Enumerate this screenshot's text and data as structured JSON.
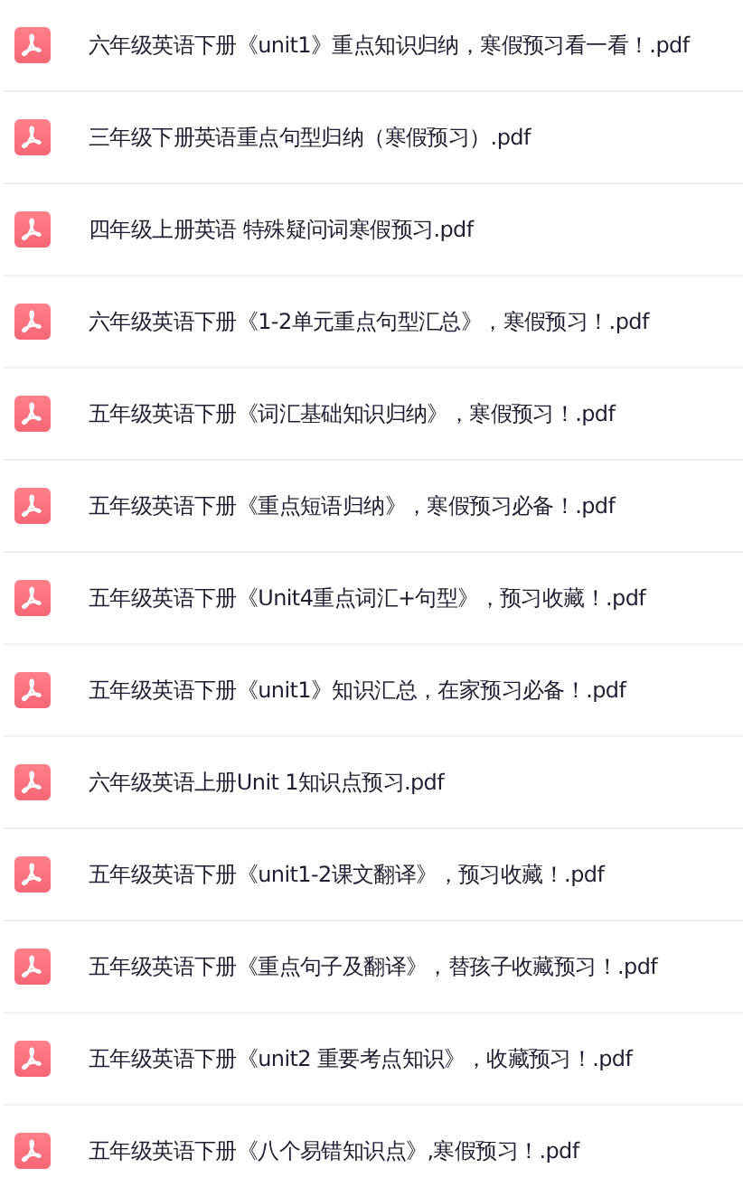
{
  "files": [
    {
      "name": "六年级英语下册《unit1》重点知识归纳，寒假预习看一看！.pdf"
    },
    {
      "name": "三年级下册英语重点句型归纳（寒假预习）.pdf"
    },
    {
      "name": "四年级上册英语 特殊疑问词寒假预习.pdf"
    },
    {
      "name": "六年级英语下册《1-2单元重点句型汇总》，寒假预习！.pdf"
    },
    {
      "name": "五年级英语下册《词汇基础知识归纳》，寒假预习！.pdf"
    },
    {
      "name": "五年级英语下册《重点短语归纳》，寒假预习必备！.pdf"
    },
    {
      "name": "五年级英语下册《Unit4重点词汇+句型》，预习收藏！.pdf"
    },
    {
      "name": "五年级英语下册《unit1》知识汇总，在家预习必备！.pdf"
    },
    {
      "name": "六年级英语上册Unit 1知识点预习.pdf"
    },
    {
      "name": "五年级英语下册《unit1-2课文翻译》，预习收藏！.pdf"
    },
    {
      "name": "五年级英语下册《重点句子及翻译》，替孩子收藏预习！.pdf"
    },
    {
      "name": "五年级英语下册《unit2 重要考点知识》，收藏预习！.pdf"
    },
    {
      "name": "五年级英语下册《八个易错知识点》,寒假预习！.pdf"
    }
  ]
}
